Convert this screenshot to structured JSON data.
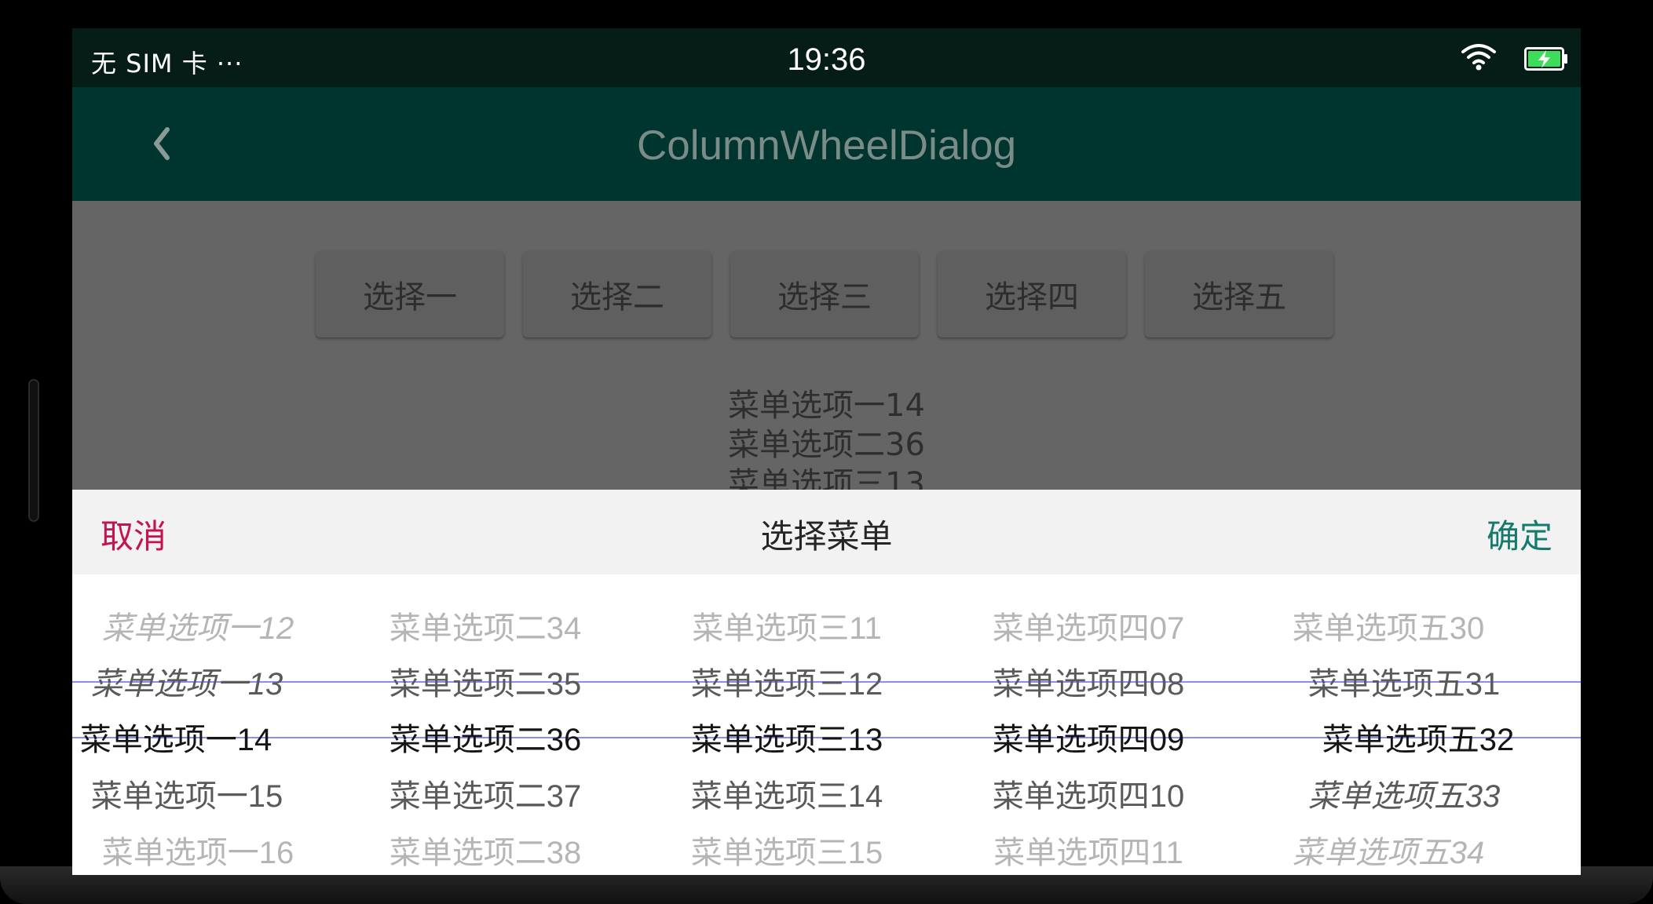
{
  "status_bar": {
    "carrier": "无 SIM 卡  ···",
    "time": "19:36"
  },
  "app_bar": {
    "title": "ColumnWheelDialog",
    "back_icon": "chevron-left-icon"
  },
  "buttons": [
    "选择一",
    "选择二",
    "选择三",
    "选择四",
    "选择五"
  ],
  "result_lines": [
    "菜单选项一14",
    "菜单选项二36",
    "菜单选项三13"
  ],
  "dialog": {
    "cancel_label": "取消",
    "title": "选择菜单",
    "confirm_label": "确定",
    "cancel_color": "#c4144e",
    "confirm_color": "#137a6c",
    "selection_line_color": "#8c8cf5"
  },
  "columns": [
    {
      "items": [
        "菜单选项一12",
        "菜单选项一13",
        "菜单选项一14",
        "菜单选项一15",
        "菜单选项一16"
      ],
      "selected": "菜单选项一14"
    },
    {
      "items": [
        "菜单选项二34",
        "菜单选项二35",
        "菜单选项二36",
        "菜单选项二37",
        "菜单选项二38"
      ],
      "selected": "菜单选项二36"
    },
    {
      "items": [
        "菜单选项三11",
        "菜单选项三12",
        "菜单选项三13",
        "菜单选项三14",
        "菜单选项三15"
      ],
      "selected": "菜单选项三13"
    },
    {
      "items": [
        "菜单选项四07",
        "菜单选项四08",
        "菜单选项四09",
        "菜单选项四10",
        "菜单选项四11"
      ],
      "selected": "菜单选项四09"
    },
    {
      "items": [
        "菜单选项五30",
        "菜单选项五31",
        "菜单选项五32",
        "菜单选项五33",
        "菜单选项五34"
      ],
      "selected": "菜单选项五32"
    }
  ]
}
